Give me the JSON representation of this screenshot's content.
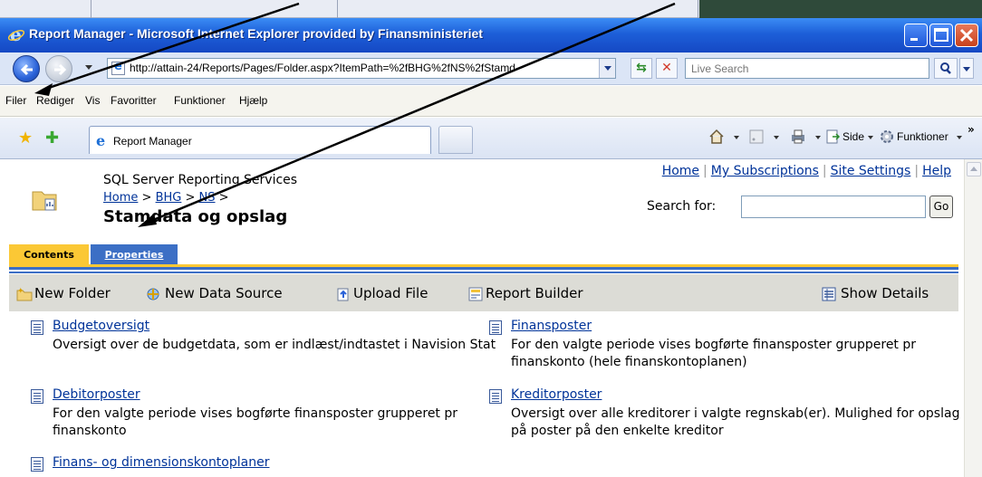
{
  "window": {
    "title": "Report Manager - Microsoft Internet Explorer provided by Finansministeriet"
  },
  "addressbar": {
    "url": "http://attain-24/Reports/Pages/Folder.aspx?ItemPath=%2fBHG%2fNS%2fStamd",
    "search_placeholder": "Live Search"
  },
  "menu": {
    "items": [
      "Filer",
      "Rediger",
      "Vis",
      "Favoritter",
      "Funktioner",
      "Hjælp"
    ]
  },
  "tabbar": {
    "active_tab": "Report Manager",
    "page_label": "Side",
    "tools_label": "Funktioner"
  },
  "page": {
    "product": "SQL Server Reporting Services",
    "breadcrumb": [
      "Home",
      "BHG",
      "NS"
    ],
    "breadcrumb_sep": ">",
    "title": "Stamdata og opslag",
    "toplinks": [
      "Home",
      "My Subscriptions",
      "Site Settings",
      "Help"
    ],
    "search_label": "Search for:",
    "go_label": "Go",
    "tabs": [
      "Contents",
      "Properties"
    ],
    "toolbar": {
      "new_folder": "New Folder",
      "new_data_source": "New Data Source",
      "upload_file": "Upload File",
      "report_builder": "Report Builder",
      "show_details": "Show Details"
    },
    "items": [
      {
        "name": "Budgetoversigt",
        "desc": "Oversigt over de budgetdata, som er indlæst/indtastet i Navision Stat"
      },
      {
        "name": "Finansposter",
        "desc": "For den valgte periode vises bogførte finansposter grupperet pr finanskonto (hele finanskontoplanen)"
      },
      {
        "name": "Debitorposter",
        "desc": "For den valgte periode vises bogførte finansposter grupperet pr finanskonto"
      },
      {
        "name": "Kreditorposter",
        "desc": "Oversigt over alle kreditorer i valgte regnskab(er). Mulighed for opslag på poster på den enkelte kreditor"
      },
      {
        "name": "Finans- og dimensionskontoplaner",
        "desc": ""
      }
    ]
  }
}
